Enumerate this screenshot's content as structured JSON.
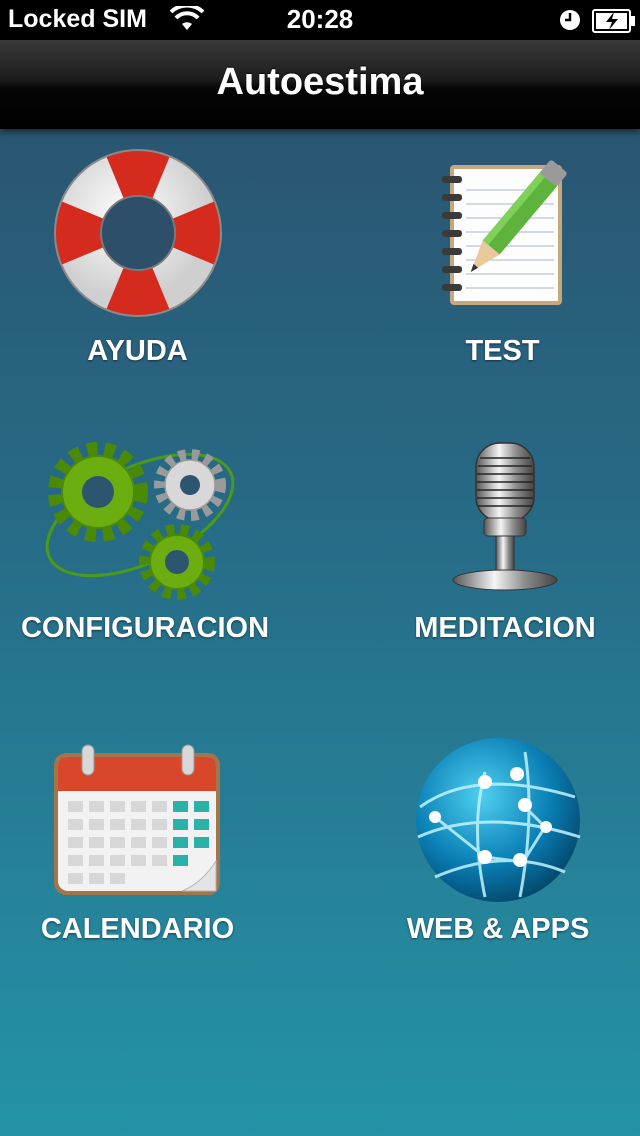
{
  "status_bar": {
    "carrier": "Locked SIM",
    "time": "20:28",
    "wifi_icon": "wifi-icon",
    "clock_icon": "clock-icon",
    "battery_icon": "battery-charging-icon"
  },
  "nav_bar": {
    "title": "Autoestima"
  },
  "menu": {
    "ayuda": {
      "label": "AYUDA",
      "icon": "lifebuoy-icon"
    },
    "test": {
      "label": "TEST",
      "icon": "notebook-pencil-icon"
    },
    "configuracion": {
      "label": "CONFIGURACION",
      "icon": "gears-icon"
    },
    "meditacion": {
      "label": "MEDITACION",
      "icon": "microphone-icon"
    },
    "calendario": {
      "label": "CALENDARIO",
      "icon": "calendar-icon"
    },
    "web_apps": {
      "label": "WEB & APPS",
      "icon": "globe-network-icon"
    }
  },
  "colors": {
    "nav_bar": "#000000",
    "background_top": "#2b4f6b",
    "background_bottom": "#2493a6",
    "label_text": "#ffffff"
  }
}
